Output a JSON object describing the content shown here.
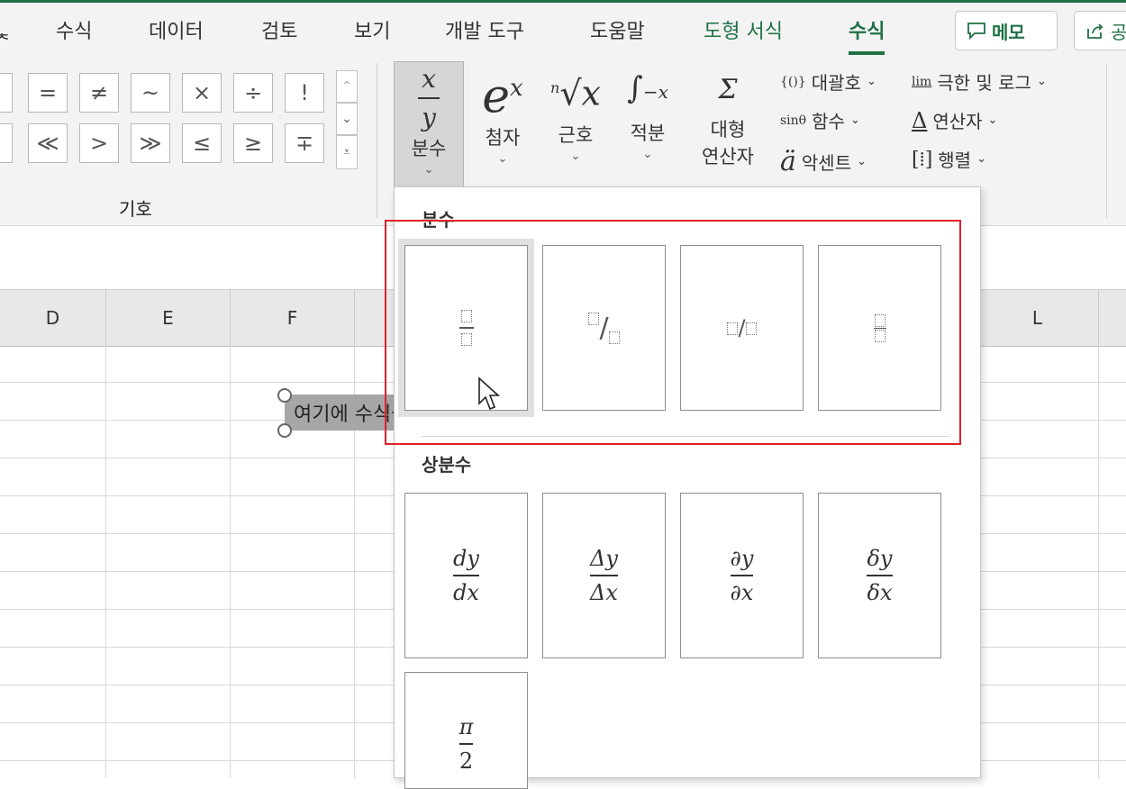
{
  "tabs": [
    {
      "label": "수식",
      "class": "tab"
    },
    {
      "label": "데이터",
      "class": "tab"
    },
    {
      "label": "검토",
      "class": "tab"
    },
    {
      "label": "보기",
      "class": "tab"
    },
    {
      "label": "개발 도구",
      "class": "tab"
    },
    {
      "label": "도움말",
      "class": "tab"
    },
    {
      "label": "도형 서식",
      "class": "tab green"
    },
    {
      "label": "수식",
      "class": "tab active"
    }
  ],
  "top_buttons": {
    "memo_label": "메모",
    "share_label": "공"
  },
  "ribbon": {
    "symbols_row1": [
      "=",
      "≠",
      "~",
      "×",
      "÷",
      "!"
    ],
    "symbols_row2": [
      "≪",
      ">",
      "≫",
      "≤",
      "≥",
      "∓"
    ],
    "symbols_group_label": "기호",
    "fraction_label": "분수",
    "script_label": "첨자",
    "radical_label": "근호",
    "integral_label": "적분",
    "large_operator_label_1": "대형",
    "large_operator_label_2": "연산자",
    "bracket_label": "대괄호",
    "function_label": "함수",
    "accent_label": "악센트",
    "limit_log_label": "극한 및 로그",
    "operator_label": "연산자",
    "matrix_label": "행렬",
    "bracket_icon_text": "{()}",
    "function_icon_text": "sinθ",
    "limit_icon_text": "lim"
  },
  "columns": [
    "D",
    "E",
    "F",
    "L"
  ],
  "equation_placeholder": "여기에 수식을 입력하십시오.",
  "dropdown": {
    "section1_title": "분수",
    "section2_title": "상분수",
    "common_fractions": [
      {
        "num": "dy",
        "den": "dx"
      },
      {
        "num": "Δy",
        "den": "Δx"
      },
      {
        "num": "∂y",
        "den": "∂x"
      },
      {
        "num": "δy",
        "den": "δx"
      },
      {
        "num": "π",
        "den": "2"
      }
    ]
  }
}
